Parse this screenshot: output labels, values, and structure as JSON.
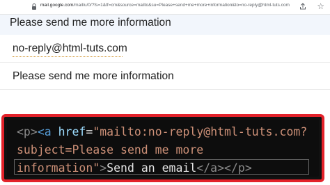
{
  "browser": {
    "url_host": "mail.google.com",
    "url_path": "/mail/u/0/?fs=1&tf=cm&source=mailto&su=Please+send+me+more+information&to=no-reply@html-tuts.com"
  },
  "compose": {
    "subject_header": "Please send me more information",
    "to_value": "no-reply@html-tuts.com",
    "subject_value": "Please send me more information"
  },
  "code": {
    "line1": {
      "open_p": "<p>",
      "open_a": "<a",
      "attr": "href",
      "eq": "=",
      "value_start": "\"mailto:no-reply@html-tuts.com?"
    },
    "line2": {
      "value_mid": "subject=Please send me more"
    },
    "line3": {
      "value_end": "information\"",
      "close_bracket": ">",
      "link_text": "Send an email",
      "close_a": "</a>",
      "close_p": "</p>"
    }
  },
  "colors": {
    "frame_border": "#e3222a",
    "code_bg": "#0d0d0d",
    "tag": "#569cd6",
    "attr": "#9cdcfe",
    "string": "#ce9178"
  }
}
